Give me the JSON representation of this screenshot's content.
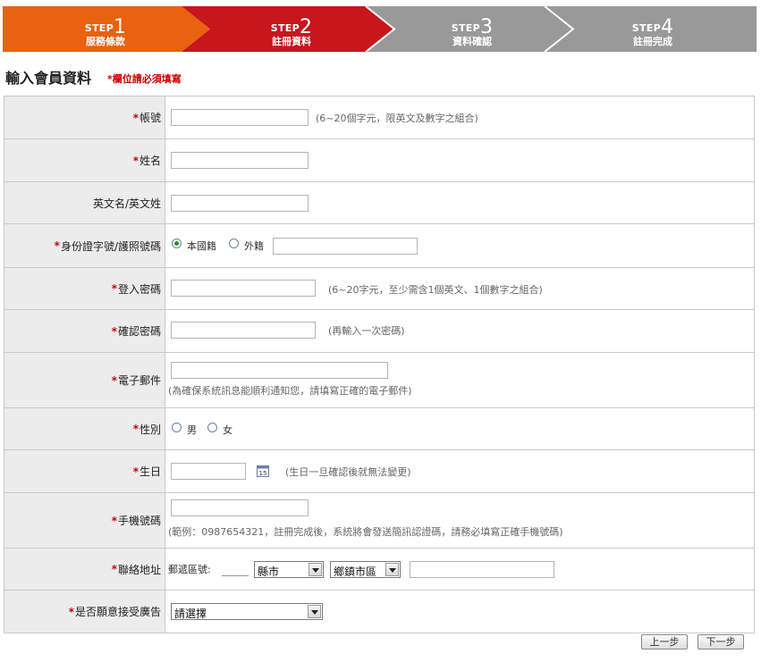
{
  "steps": [
    {
      "prefix": "STEP",
      "num": "1",
      "label": "服務條款",
      "color": "#e8620f"
    },
    {
      "prefix": "STEP",
      "num": "2",
      "label": "註冊資料",
      "color": "#c8161d"
    },
    {
      "prefix": "STEP",
      "num": "3",
      "label": "資料確認",
      "color": "#999999"
    },
    {
      "prefix": "STEP",
      "num": "4",
      "label": "註冊完成",
      "color": "#999999"
    }
  ],
  "heading": "輸入會員資料",
  "required_note": "*欄位請必須填寫",
  "fields": {
    "account": {
      "label": "帳號",
      "hint": "(6~20個字元，限英文及數字之組合)"
    },
    "name": {
      "label": "姓名"
    },
    "english_name": {
      "label": "英文名/英文姓"
    },
    "id_number": {
      "label": "身份證字號/護照號碼",
      "option_local": "本國籍",
      "option_foreign": "外籍"
    },
    "password": {
      "label": "登入密碼",
      "hint": "(6~20字元，至少需含1個英文、1個數字之組合)"
    },
    "confirm_password": {
      "label": "確認密碼",
      "hint": "(再輸入一次密碼)"
    },
    "email": {
      "label": "電子郵件",
      "hint": "(為確保系統訊息能順利通知您，請填寫正確的電子郵件)"
    },
    "gender": {
      "label": "性別",
      "option_male": "男",
      "option_female": "女"
    },
    "birthday": {
      "label": "生日",
      "hint": "(生日一旦確認後就無法變更)",
      "calendar_day": "15"
    },
    "mobile": {
      "label": "手機號碼",
      "hint": "(範例：0987654321，註冊完成後，系統將會發送簡訊認證碼，請務必填寫正確手機號碼)"
    },
    "address": {
      "label": "聯絡地址",
      "zip_label": "郵遞區號:",
      "city_select": "縣市",
      "town_select": "鄉鎮市區"
    },
    "ads": {
      "label": "是否願意接受廣告",
      "select_value": "請選擇"
    }
  },
  "required_star": "*",
  "buttons": {
    "prev": "上一步",
    "next": "下一步"
  },
  "colors": {
    "required": "#cc0000",
    "label_bg": "#ececec",
    "border": "#c9c9c9"
  }
}
